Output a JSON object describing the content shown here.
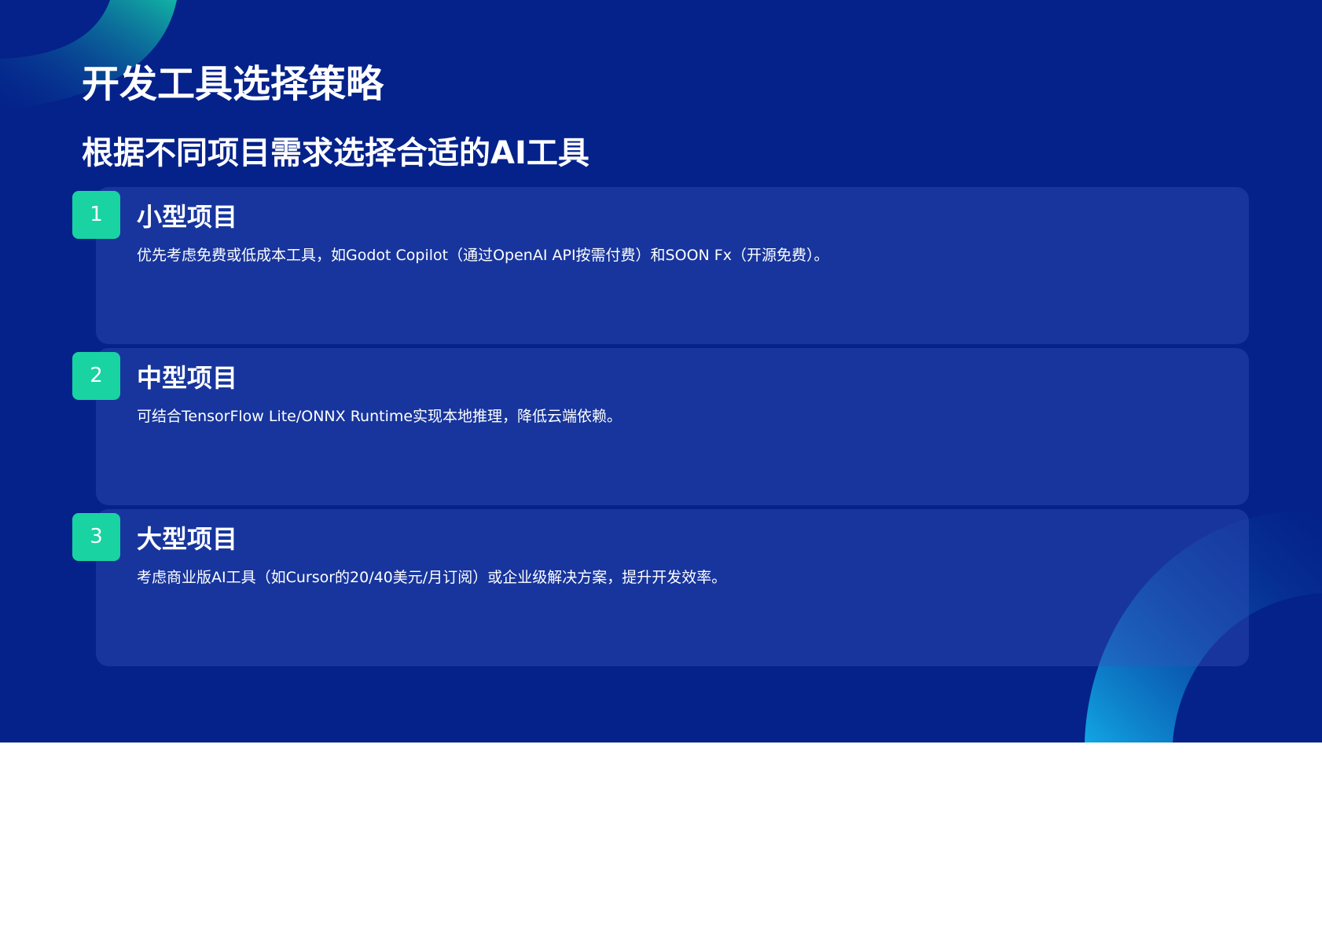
{
  "title": "开发工具选择策略",
  "subtitle": "根据不同项目需求选择合适的AI工具",
  "items": [
    {
      "number": "1",
      "title": "小型项目",
      "description": "优先考虑免费或低成本工具，如Godot Copilot（通过OpenAI API按需付费）和SOON Fx（开源免费）。"
    },
    {
      "number": "2",
      "title": "中型项目",
      "description": "可结合TensorFlow Lite/ONNX Runtime实现本地推理，降低云端依赖。"
    },
    {
      "number": "3",
      "title": "大型项目",
      "description": "考虑商业版AI工具（如Cursor的20/40美元/月订阅）或企业级解决方案，提升开发效率。"
    }
  ],
  "colors": {
    "background": "#04228a",
    "accent": "#19d3a2",
    "card": "#2a48b4"
  }
}
